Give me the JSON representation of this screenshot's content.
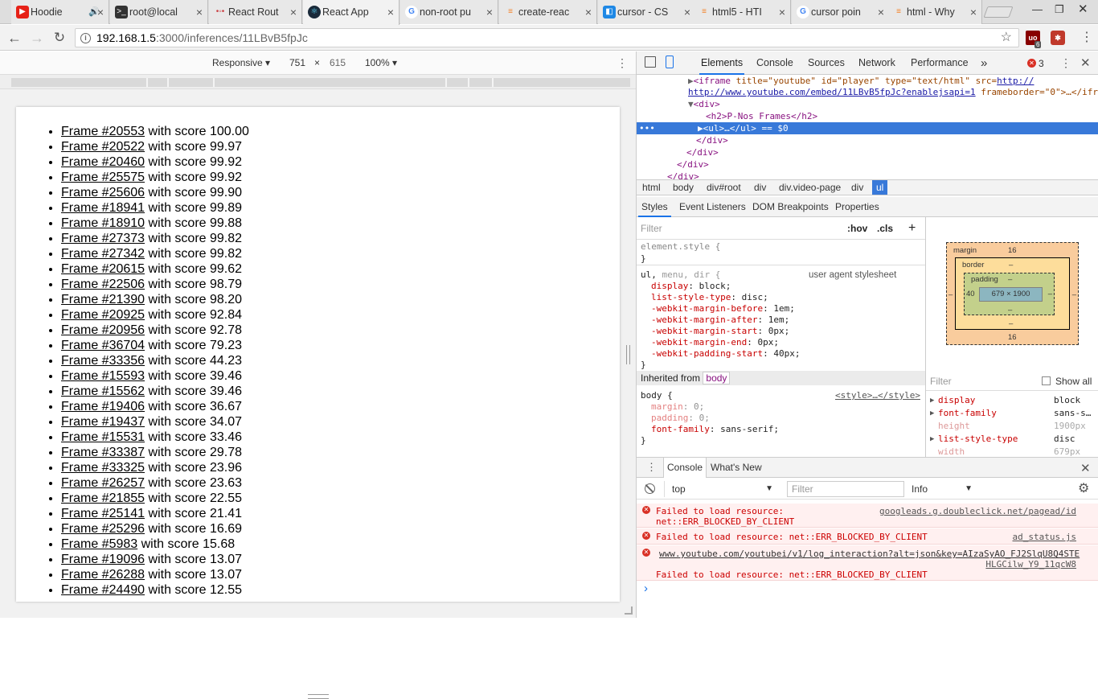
{
  "tabs": [
    {
      "title": "Hoodie",
      "icon": "youtube-icon",
      "color": "#e62117"
    },
    {
      "title": "root@local",
      "icon": "terminal-icon",
      "color": "#333333"
    },
    {
      "title": "React Rout",
      "icon": "react-router-icon",
      "color": "#ca4245"
    },
    {
      "title": "React App",
      "icon": "react-icon",
      "color": "#1a2a3a"
    },
    {
      "title": "non-root pu",
      "icon": "google-icon",
      "color": "#4285f4"
    },
    {
      "title": "create-reac",
      "icon": "stackoverflow-icon",
      "color": "#f48024"
    },
    {
      "title": "cursor - CS",
      "icon": "cursor-icon",
      "color": "#1e88e5"
    },
    {
      "title": "html5 - HTI",
      "icon": "stackoverflow-icon",
      "color": "#f48024"
    },
    {
      "title": "cursor poin",
      "icon": "google-icon",
      "color": "#4285f4"
    },
    {
      "title": "html - Why",
      "icon": "stackoverflow-icon",
      "color": "#f48024"
    }
  ],
  "address": {
    "host": "192.168.1.5",
    "path": ":3000/inferences/11LBvB5fpJc"
  },
  "device": {
    "mode": "Responsive",
    "width": "751",
    "x": "×",
    "height": "615",
    "zoom": "100%"
  },
  "frames": [
    {
      "label": "Frame #20553",
      "score": "with score 100.00"
    },
    {
      "label": "Frame #20522",
      "score": "with score 99.97"
    },
    {
      "label": "Frame #20460",
      "score": "with score 99.92"
    },
    {
      "label": "Frame #25575",
      "score": "with score 99.92"
    },
    {
      "label": "Frame #25606",
      "score": "with score 99.90"
    },
    {
      "label": "Frame #18941",
      "score": "with score 99.89"
    },
    {
      "label": "Frame #18910",
      "score": "with score 99.88"
    },
    {
      "label": "Frame #27373",
      "score": "with score 99.82"
    },
    {
      "label": "Frame #27342",
      "score": "with score 99.82"
    },
    {
      "label": "Frame #20615",
      "score": "with score 99.62"
    },
    {
      "label": "Frame #22506",
      "score": "with score 98.79"
    },
    {
      "label": "Frame #21390",
      "score": "with score 98.20"
    },
    {
      "label": "Frame #20925",
      "score": "with score 92.84"
    },
    {
      "label": "Frame #20956",
      "score": "with score 92.78"
    },
    {
      "label": "Frame #36704",
      "score": "with score 79.23"
    },
    {
      "label": "Frame #33356",
      "score": "with score 44.23"
    },
    {
      "label": "Frame #15593",
      "score": "with score 39.46"
    },
    {
      "label": "Frame #15562",
      "score": "with score 39.46"
    },
    {
      "label": "Frame #19406",
      "score": "with score 36.67"
    },
    {
      "label": "Frame #19437",
      "score": "with score 34.07"
    },
    {
      "label": "Frame #15531",
      "score": "with score 33.46"
    },
    {
      "label": "Frame #33387",
      "score": "with score 29.78"
    },
    {
      "label": "Frame #33325",
      "score": "with score 23.96"
    },
    {
      "label": "Frame #26257",
      "score": "with score 23.63"
    },
    {
      "label": "Frame #21855",
      "score": "with score 22.55"
    },
    {
      "label": "Frame #25141",
      "score": "with score 21.41"
    },
    {
      "label": "Frame #25296",
      "score": "with score 16.69"
    },
    {
      "label": "Frame #5983",
      "score": "with score 15.68"
    },
    {
      "label": "Frame #19096",
      "score": "with score 13.07"
    },
    {
      "label": "Frame #26288",
      "score": "with score 13.07"
    },
    {
      "label": "Frame #24490",
      "score": "with score 12.55"
    }
  ],
  "devtools": {
    "tabs": [
      "Elements",
      "Console",
      "Sources",
      "Network",
      "Performance"
    ],
    "more": "»",
    "error_count": "3",
    "dom": {
      "iframe_open": "<iframe",
      "iframe_attrs": " title=\"youtube\" id=\"player\" type=\"text/html\" src=",
      "iframe_src": "http://www.youtube.com/embed/11LBvB5fpJc?enablejsapi=1",
      "iframe_tail": " frameborder=\"0\">…</iframe>",
      "div_open": "<div>",
      "h2": "<h2>P-Nos Frames</h2>",
      "ul": "<ul>…</ul> == $0",
      "div_close": "</div>"
    },
    "crumbs": [
      "html",
      "body",
      "div#root",
      "div",
      "div.video-page",
      "div",
      "ul"
    ],
    "style_tabs": [
      "Styles",
      "Event Listeners",
      "DOM Breakpoints",
      "Properties"
    ],
    "filter_placeholder": "Filter",
    "hov": ":hov",
    "cls": ".cls",
    "plus": "+",
    "element_style": "element.style {",
    "close_brace": "}",
    "ul_selector": "ul,",
    "ul_selector_rest": "menu, dir {",
    "ua_label": "user agent stylesheet",
    "ul_props": [
      {
        "k": "display",
        "v": "block;"
      },
      {
        "k": "list-style-type",
        "v": "disc;"
      },
      {
        "k": "-webkit-margin-before",
        "v": "1em;"
      },
      {
        "k": "-webkit-margin-after",
        "v": "1em;"
      },
      {
        "k": "-webkit-margin-start",
        "v": "0px;"
      },
      {
        "k": "-webkit-margin-end",
        "v": "0px;"
      },
      {
        "k": "-webkit-padding-start",
        "v": "40px;"
      }
    ],
    "inherited": "Inherited from",
    "inherited_tag": "body",
    "body_selector": "body {",
    "style_src": "<style>…</style>",
    "body_props": [
      {
        "k": "margin",
        "v": "0;"
      },
      {
        "k": "padding",
        "v": "0;"
      },
      {
        "k": "font-family",
        "v": "sans-serif;"
      }
    ],
    "boxmodel": {
      "margin": "margin",
      "margin_val": "16",
      "border": "border",
      "dash": "–",
      "padding": "padding",
      "pad_left": "40",
      "content": "679 × 1900"
    },
    "computed_filter": "Filter",
    "show_all": "Show all",
    "computed": [
      {
        "k": "display",
        "v": "block",
        "expand": true
      },
      {
        "k": "font-family",
        "v": "sans-s…",
        "expand": true
      },
      {
        "k": "height",
        "v": "1900px",
        "expand": false
      },
      {
        "k": "list-style-type",
        "v": "disc",
        "expand": true
      },
      {
        "k": "width",
        "v": "679px",
        "expand": false
      }
    ],
    "console_tabs": [
      "Console",
      "What's New"
    ],
    "context": "top",
    "console_filter": "Filter",
    "level": "Info",
    "messages": [
      {
        "text": "Failed to load resource:",
        "text2": "net::ERR_BLOCKED_BY_CLIENT",
        "src": "googleads.g.doubleclick.net/pagead/id"
      },
      {
        "text": "Failed to load resource: net::ERR_BLOCKED_BY_CLIENT",
        "src": "ad_status.js"
      },
      {
        "url": "www.youtube.com/youtubei/v1/log_interaction?alt=json&key=AIzaSyAO_FJ2SlqU8Q4STE",
        "url2": "HLGCilw_Y9_11qcW8",
        "text": "Failed to load resource: net::ERR_BLOCKED_BY_CLIENT"
      }
    ],
    "prompt": "›"
  }
}
